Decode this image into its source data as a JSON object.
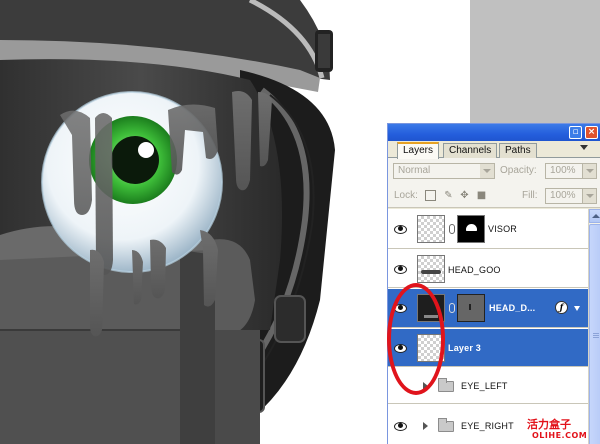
{
  "panel": {
    "tabs": [
      {
        "label": "Layers",
        "active": true
      },
      {
        "label": "Channels",
        "active": false
      },
      {
        "label": "Paths",
        "active": false
      }
    ],
    "blend_mode": "Normal",
    "opacity_label": "Opacity:",
    "opacity_value": "100%",
    "lock_label": "Lock:",
    "fill_label": "Fill:",
    "fill_value": "100%"
  },
  "layers": [
    {
      "name": "VISOR",
      "visible": true,
      "selected": false,
      "has_mask": true
    },
    {
      "name": "HEAD_GOO",
      "visible": true,
      "selected": false,
      "has_mask": false
    },
    {
      "name": "HEAD_D...",
      "visible": true,
      "selected": true,
      "has_mask": true,
      "has_fx": true
    },
    {
      "name": "Layer 3",
      "visible": true,
      "selected": true,
      "has_mask": false
    },
    {
      "name": "EYE_LEFT",
      "visible": false,
      "selected": false,
      "is_group": true
    },
    {
      "name": "EYE_RIGHT",
      "visible": true,
      "selected": false,
      "is_group": true
    }
  ],
  "watermark": {
    "cn": "活力盒子",
    "en": "OLIHE.COM"
  },
  "colors": {
    "selection": "#316ac5",
    "titlebar": "#245edc",
    "highlight_ring": "#e0141c",
    "eye_iris": "#3fbf3a"
  }
}
